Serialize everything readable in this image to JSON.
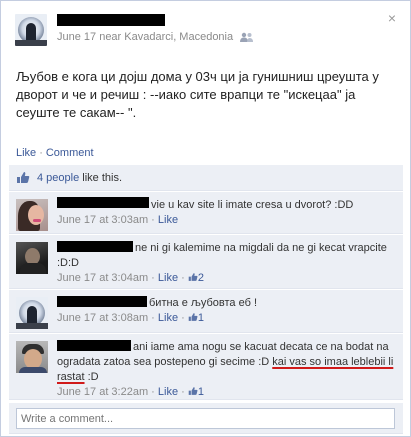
{
  "post": {
    "meta_text": "June 17 near Kavadarci, Macedonia",
    "status_text": "Љубов е кога ци дојш дома у 03ч ци ја гунишниш цреушта у дворот и че и речиш : --иако сите врапци те \"искецаа\" ја сеуште те сакам-- \".",
    "close_glyph": "×",
    "audience_icon": "people-icon"
  },
  "actions": {
    "like": "Like",
    "separator": "·",
    "comment": "Comment"
  },
  "likes": {
    "count_link": "4 people",
    "suffix": " like this.",
    "icon": "thumbs-up-icon"
  },
  "comments": [
    {
      "text": "vie u kav site li imate cresa u dvorot? :DD",
      "time": "June 17 at 3:03am",
      "like": "Like",
      "likes_count": ""
    },
    {
      "text": "ne ni gi kalemime na migdali da ne gi kecat vrapcite :D:D",
      "time": "June 17 at 3:04am",
      "like": "Like",
      "likes_count": "2"
    },
    {
      "text": "битна е љубовта еб !",
      "time": "June 17 at 3:08am",
      "like": "Like",
      "likes_count": "1"
    },
    {
      "text_a": "ani iame ama nogu se kacuat decata ce na bodat na ogradata zatoa sea postepeno gi secime :D ",
      "text_b": "kai vas so imaa leblebii li rastat",
      "text_c": " :D",
      "time": "June 17 at 3:22am",
      "like": "Like",
      "likes_count": "1"
    }
  ],
  "composer": {
    "placeholder": "Write a comment..."
  },
  "colors": {
    "link": "#3b5998",
    "comment_bg": "#eceff5",
    "redaction": "#000000",
    "annotation_underline": "#d01a1a"
  }
}
